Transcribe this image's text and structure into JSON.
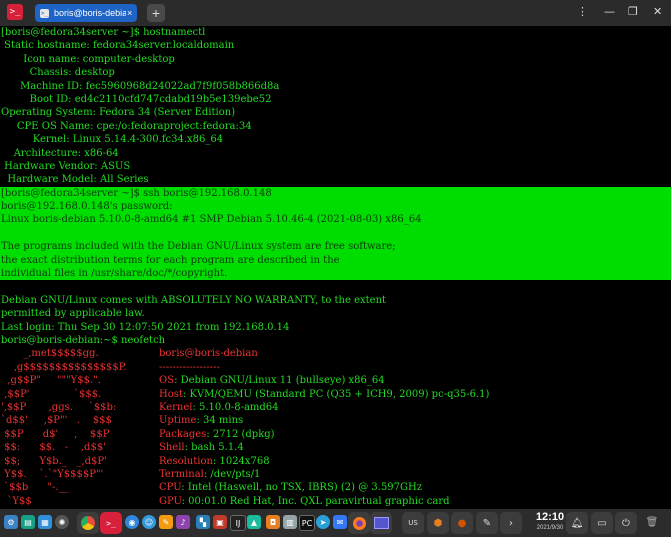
{
  "window": {
    "tab_label": "boris@boris-debian: ~",
    "tab_close": "×",
    "new_tab": "+",
    "controls": [
      "⋮",
      "—",
      "❐",
      "✕"
    ]
  },
  "terminal": {
    "lines_top": [
      "[boris@fedora34server ~]$ hostnamectl",
      " Static hostname: fedora34server.localdomain",
      "       Icon name: computer-desktop",
      "         Chassis: desktop",
      "      Machine ID: fec5960968d24022ad7f9f058b866d8a",
      "         Boot ID: ed4c2110cfd747cdabd19b5e139ebe52",
      "Operating System: Fedora 34 (Server Edition)",
      "     CPE OS Name: cpe:/o:fedoraproject:fedora:34",
      "          Kernel: Linux 5.14.4-300.fc34.x86_64",
      "    Architecture: x86-64",
      " Hardware Vendor: ASUS",
      "  Hardware Model: All Series"
    ],
    "lines_highlight": [
      "[boris@fedora34server ~]$ ssh boris@192.168.0.148",
      "boris@192.168.0.148's password:",
      "Linux boris-debian 5.10.0-8-amd64 #1 SMP Debian 5.10.46-4 (2021-08-03) x86_64",
      "",
      "The programs included with the Debian GNU/Linux system are free software;",
      "the exact distribution terms for each program are described in the",
      "individual files in /usr/share/doc/*/copyright."
    ],
    "lines_after": [
      "",
      "Debian GNU/Linux comes with ABSOLUTELY NO WARRANTY, to the extent",
      "permitted by applicable law.",
      "Last login: Thu Sep 30 12:07:50 2021 from 192.168.0.14",
      "boris@boris-debian:~$ neofetch"
    ],
    "neofetch": [
      {
        "logo": "       _,met$$$$$gg.",
        "key": "boris@boris-debian",
        "val": ""
      },
      {
        "logo": "    ,g$$$$$$$$$$$$$$$P.",
        "key": "------------------",
        "val": ""
      },
      {
        "logo": "  ,g$$P\"     \"\"\"Y$$.\".",
        "key": "OS",
        "val": ": Debian GNU/Linux 11 (bullseye) x86_64"
      },
      {
        "logo": " ,$$P'              `$$$.",
        "key": "Host",
        "val": ": KVM/QEMU (Standard PC (Q35 + ICH9, 2009) pc-q35-6.1)"
      },
      {
        "logo": "',$$P       ,ggs.     `$$b:",
        "key": "Kernel",
        "val": ": 5.10.0-8-amd64"
      },
      {
        "logo": "`d$$'     ,$P\"'   .    $$$",
        "key": "Uptime",
        "val": ": 34 mins"
      },
      {
        "logo": " $$P      d$'     ,    $$P",
        "key": "Packages",
        "val": ": 2712 (dpkg)"
      },
      {
        "logo": " $$:      $$.   -    ,d$$'",
        "key": "Shell",
        "val": ": bash 5.1.4"
      },
      {
        "logo": " $$;      Y$b._   _,d$P'",
        "key": "Resolution",
        "val": ": 1024x768"
      },
      {
        "logo": " Y$$.    `.`\"Y$$$$P\"'",
        "key": "Terminal",
        "val": ": /dev/pts/1"
      },
      {
        "logo": " `$$b      \"-.__",
        "key": "CPU",
        "val": ": Intel (Haswell, no TSX, IBRS) (2) @ 3.597GHz"
      },
      {
        "logo": "  `Y$$",
        "key": "GPU",
        "val": ": 00:01.0 Red Hat, Inc. QXL paravirtual graphic card"
      }
    ]
  },
  "taskbar": {
    "lang": "US",
    "time": "12:10",
    "date": "2021/9/30",
    "colors": {
      "red": "#d8203a",
      "blue": "#1e63c6",
      "green_text": "#22dd22",
      "highlight": "#00dd00"
    }
  }
}
